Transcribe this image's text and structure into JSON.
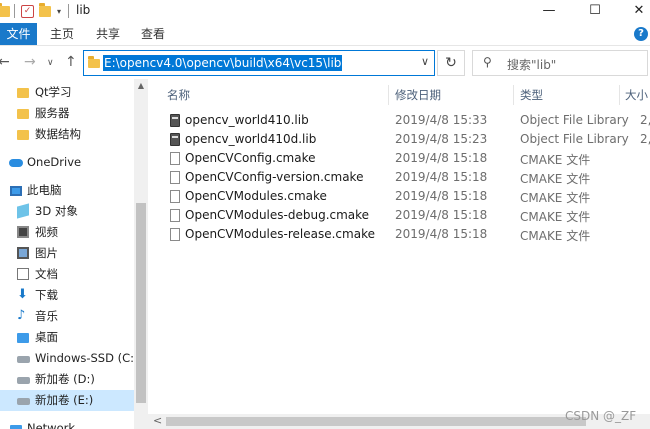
{
  "window": {
    "title": "lib",
    "minimize_glyph": "—",
    "maximize_glyph": "☐",
    "close_glyph": "✕"
  },
  "ribbon": {
    "tabs": [
      "文件",
      "主页",
      "共享",
      "查看"
    ]
  },
  "address_bar": {
    "path": "E:\\opencv4.0\\opencv\\build\\x64\\vc15\\lib"
  },
  "search": {
    "placeholder": "搜索\"lib\""
  },
  "sidebar": {
    "items": [
      {
        "label": "Qt学习",
        "icon": "folder-icon"
      },
      {
        "label": "服务器",
        "icon": "folder-icon"
      },
      {
        "label": "数据结构",
        "icon": "folder-icon"
      },
      {
        "label": "OneDrive",
        "icon": "cloud-icon"
      },
      {
        "label": "此电脑",
        "icon": "computer-icon"
      },
      {
        "label": "3D 对象",
        "icon": "cube-icon"
      },
      {
        "label": "视频",
        "icon": "video-icon"
      },
      {
        "label": "图片",
        "icon": "picture-icon"
      },
      {
        "label": "文档",
        "icon": "document-icon"
      },
      {
        "label": "下载",
        "icon": "download-icon"
      },
      {
        "label": "音乐",
        "icon": "music-icon"
      },
      {
        "label": "桌面",
        "icon": "desktop-icon"
      },
      {
        "label": "Windows-SSD (C:)",
        "icon": "drive-icon"
      },
      {
        "label": "新加卷 (D:)",
        "icon": "drive-icon"
      },
      {
        "label": "新加卷 (E:)",
        "icon": "drive-icon",
        "selected": true
      },
      {
        "label": "Network",
        "icon": "network-icon"
      }
    ]
  },
  "columns": {
    "name": "名称",
    "date": "修改日期",
    "type": "类型",
    "size": "大小"
  },
  "files": [
    {
      "name": "opencv_world410.lib",
      "date": "2019/4/8 15:33",
      "type": "Object File Library",
      "size": "2,",
      "icon": "library-file-icon"
    },
    {
      "name": "opencv_world410d.lib",
      "date": "2019/4/8 15:23",
      "type": "Object File Library",
      "size": "2,",
      "icon": "library-file-icon"
    },
    {
      "name": "OpenCVConfig.cmake",
      "date": "2019/4/8 15:18",
      "type": "CMAKE 文件",
      "size": "",
      "icon": "cmake-file-icon"
    },
    {
      "name": "OpenCVConfig-version.cmake",
      "date": "2019/4/8 15:18",
      "type": "CMAKE 文件",
      "size": "",
      "icon": "cmake-file-icon"
    },
    {
      "name": "OpenCVModules.cmake",
      "date": "2019/4/8 15:18",
      "type": "CMAKE 文件",
      "size": "",
      "icon": "cmake-file-icon"
    },
    {
      "name": "OpenCVModules-debug.cmake",
      "date": "2019/4/8 15:18",
      "type": "CMAKE 文件",
      "size": "",
      "icon": "cmake-file-icon"
    },
    {
      "name": "OpenCVModules-release.cmake",
      "date": "2019/4/8 15:18",
      "type": "CMAKE 文件",
      "size": "",
      "icon": "cmake-file-icon"
    }
  ],
  "watermark": "CSDN @_ZF",
  "colors": {
    "accent": "#0078d7",
    "file_tab": "#1979ca",
    "selection": "#cce8ff"
  }
}
